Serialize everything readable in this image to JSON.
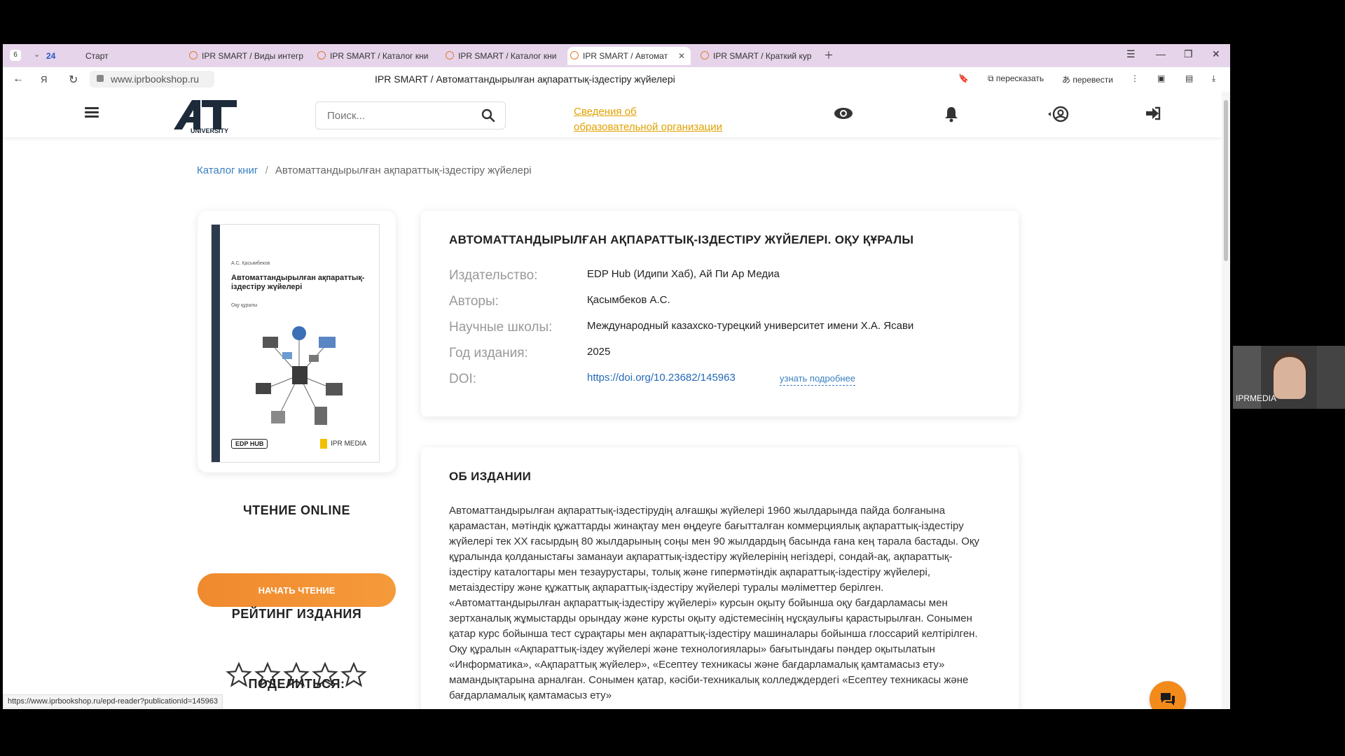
{
  "browser": {
    "tab_count": "6",
    "tab_zen": "24",
    "tabs": [
      {
        "label": "Старт"
      },
      {
        "label": "IPR SMART / Виды интегр"
      },
      {
        "label": "IPR SMART / Каталог кни"
      },
      {
        "label": "IPR SMART / Каталог кни"
      },
      {
        "label": "IPR SMART / Автомат"
      },
      {
        "label": "IPR SMART / Краткий кур"
      }
    ],
    "url": "www.iprbookshop.ru",
    "page_title": "IPR SMART / Автоматтандырылған ақпараттық-іздестіру жүйелері",
    "retell_label": "пересказать",
    "translate_label": "перевести",
    "status_url": "https://www.iprbookshop.ru/epd-reader?publicationId=145963"
  },
  "header": {
    "logo_text": "AT",
    "logo_sub": "UNIVERSITY",
    "search_placeholder": "Поиск...",
    "org_link_line1": "Сведения об",
    "org_link_line2": "образовательной организации"
  },
  "breadcrumb": {
    "catalog": "Каталог книг",
    "separator": "/",
    "current": "Автоматтандырылған ақпараттық-іздестіру жүйелері"
  },
  "cover": {
    "author": "А.С. Қасымбеков",
    "title": "Автоматтандырылған ақпараттық-іздестіру жүйелері",
    "subtitle": "Оқу құралы",
    "publisher1": "EDP HUB",
    "publisher2": "IPR MEDIA"
  },
  "sidebar": {
    "read_online": "ЧТЕНИЕ ONLINE",
    "start_reading": "НАЧАТЬ ЧТЕНИЕ",
    "rating": "РЕЙТИНГ ИЗДАНИЯ",
    "rating_value": 0,
    "rating_max": 5,
    "share": "ПОДЕЛИТЬСЯ:"
  },
  "book": {
    "title": "АВТОМАТТАНДЫРЫЛҒАН АҚПАРАТТЫҚ-ІЗДЕСТІРУ ЖҮЙЕЛЕРІ. ОҚУ ҚҰРАЛЫ",
    "publisher_label": "Издательство:",
    "publisher": "EDP Hub (Идипи Хаб), Ай Пи Ар Медиа",
    "authors_label": "Авторы:",
    "authors": "Қасымбеков А.С.",
    "schools_label": "Научные школы:",
    "schools": "Международный казахско-турецкий университет имени Х.А. Ясави",
    "year_label": "Год издания:",
    "year": "2025",
    "doi_label": "DOI:",
    "doi": "https://doi.org/10.23682/145963",
    "more": "узнать подробнее"
  },
  "about": {
    "heading": "ОБ ИЗДАНИИ",
    "text": "Автоматтандырылған ақпараттық-іздестірудің алғашқы жүйелері 1960 жылдарында пайда болғанына қарамастан, мәтіндік құжаттарды жинақтау мен өңдеуге бағытталған коммерциялық ақпараттық-іздестіру жүйелері тек XX ғасырдың 80 жылдарының соңы мен 90 жылдардың басында ғана кең тарала бастады. Оқу құралында қолданыстағы заманауи ақпараттық-іздестіру жүйелерінің негіздері, сондай-ақ, ақпараттық-іздестіру каталогтары мен тезаурустары, толық және гипермәтіндік ақпараттық-іздестіру жүйелері, метаіздестіру және құжаттық ақпараттық-іздестіру жүйелері туралы мәліметтер берілген. «Автоматтандырылған ақпараттық-іздестіру жүйелері» курсын оқыту бойынша оқу бағдарламасы мен зертханалық жұмыстарды орындау және курсты оқыту әдістемесінің нұсқаулығы қарастырылған. Сонымен қатар курс бойынша тест сұрақтары мен ақпараттық-іздестіру машиналары бойынша глоссарий келтірілген. Оқу құралын «Ақпараттық-іздеу жүйелері және технологиялары» бағытындағы пәндер оқытылатын «Информатика», «Ақпараттық жүйелер», «Есептеу техникасы және бағдарламалық қамтамасыз ету» мамандықтарына арналған. Сонымен қатар, кәсіби-техникалық колледждердегі «Есептеу техникасы және бағдарламалық қамтамасыз ету»"
  },
  "video": {
    "label": "IPRMEDIA"
  },
  "colors": {
    "accent": "#f08a2e",
    "link": "#2569b8",
    "org_link": "#e0a100"
  }
}
